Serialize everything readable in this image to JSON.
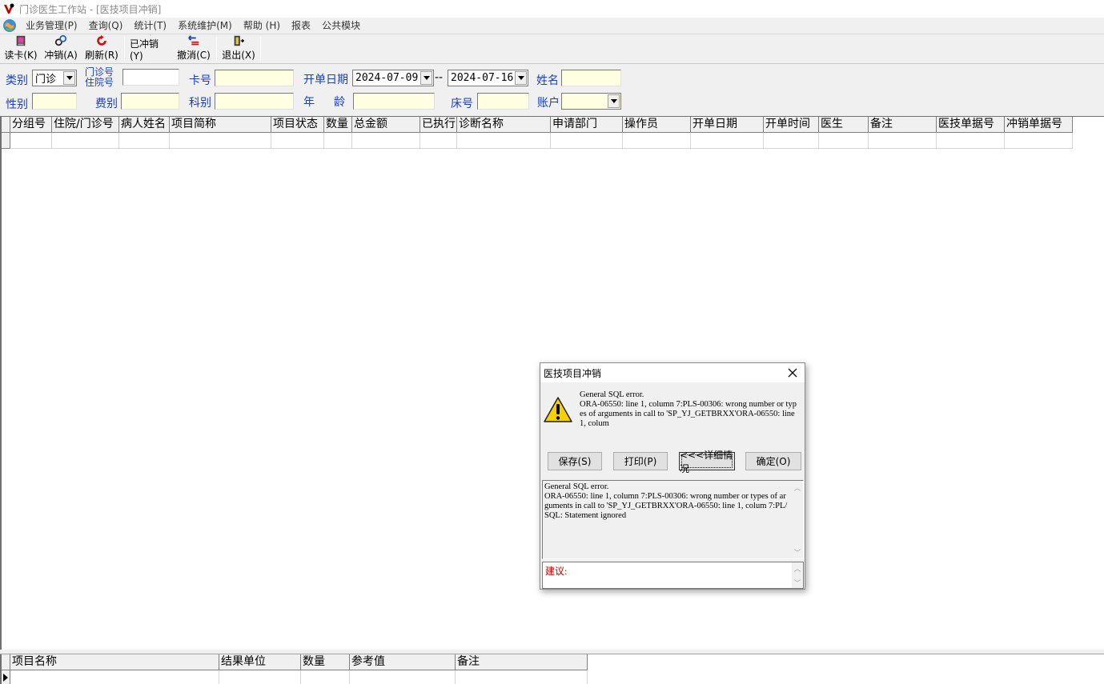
{
  "window": {
    "title": "门诊医生工作站 - [医技项目冲销]"
  },
  "menu": [
    "业务管理(P)",
    "查询(Q)",
    "统计(T)",
    "系统维护(M)",
    "帮助 (H)",
    "报表",
    "公共模块"
  ],
  "toolbar": {
    "read_card": "读卡(K)",
    "reverse": "冲销(A)",
    "refresh": "刷新(R)",
    "reversed": "已冲销(Y)",
    "cancel": "撤消(C)",
    "exit": "退出(X)"
  },
  "filters": {
    "category_label": "类别",
    "category_value": "门诊",
    "outpatient_no_label_1": "门诊号",
    "outpatient_no_label_2": "住院号",
    "outpatient_no_value": "",
    "card_no_label": "卡号",
    "card_no_value": "",
    "open_date_label": "开单日期",
    "date_from": "2024-07-09",
    "date_sep": "--",
    "date_to": "2024-07-16",
    "name_label": "姓名",
    "name_value": "",
    "gender_label": "性别",
    "gender_value": "",
    "fee_type_label": "费别",
    "fee_type_value": "",
    "dept_label": "科别",
    "dept_value": "",
    "age_label_1": "年",
    "age_label_2": "龄",
    "age_value": "",
    "bed_label": "床号",
    "bed_value": "",
    "account_label": "账户",
    "account_value": ""
  },
  "main_grid": {
    "columns": [
      "分组号",
      "住院/门诊号",
      "病人姓名",
      "项目简称",
      "项目状态",
      "数量",
      "总金额",
      "已执行",
      "诊断名称",
      "申请部门",
      "操作员",
      "开单日期",
      "开单时间",
      "医生",
      "备注",
      "医技单据号",
      "冲销单据号"
    ]
  },
  "detail_grid": {
    "columns": [
      "项目名称",
      "结果单位",
      "数量",
      "参考值",
      "备注"
    ]
  },
  "dialog": {
    "title": "医技项目冲销",
    "message": "General SQL error.\nORA-06550: line 1, column 7:PLS-00306: wrong number or types of arguments in call to 'SP_YJ_GETBRXX'ORA-06550: line 1, colum",
    "buttons": {
      "save": "保存(S)",
      "print": "打印(P)",
      "details": "<<<详细情况",
      "ok": "确定(O)"
    },
    "detail_text": "General SQL error.\nORA-06550: line 1, column 7:PLS-00306: wrong number or types of arguments in call to 'SP_YJ_GETBRXX'ORA-06550: line 1, colum 7:PL/SQL: Statement ignored",
    "advice_label": "建议:"
  }
}
